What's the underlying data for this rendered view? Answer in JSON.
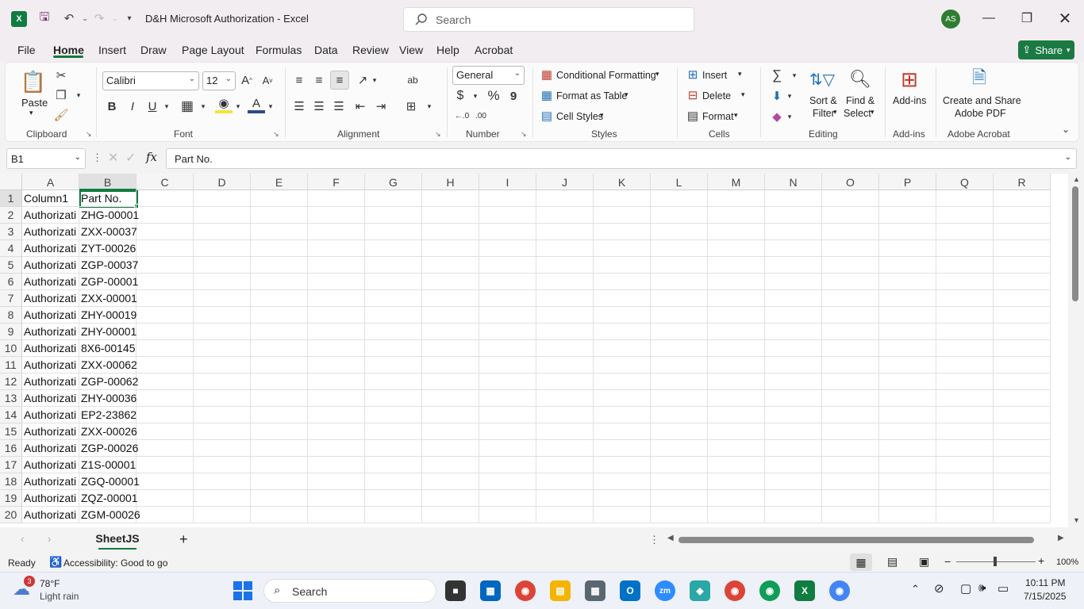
{
  "window": {
    "title": "D&H Microsoft Authorization  -  Excel",
    "search_placeholder": "Search",
    "avatar_initials": "AS"
  },
  "menu": [
    "File",
    "Home",
    "Insert",
    "Draw",
    "Page Layout",
    "Formulas",
    "Data",
    "Review",
    "View",
    "Help",
    "Acrobat"
  ],
  "share_label": "Share",
  "ribbon": {
    "clipboard": {
      "paste": "Paste",
      "label": "Clipboard"
    },
    "font": {
      "name": "Calibri",
      "size": "12",
      "label": "Font",
      "bold": "B",
      "italic": "I",
      "underline": "U"
    },
    "alignment": {
      "label": "Alignment"
    },
    "number": {
      "format": "General",
      "label": "Number",
      "currency": "$",
      "percent": "%",
      "comma": "9"
    },
    "styles": {
      "conditional": "Conditional Formatting",
      "table": "Format as Table",
      "cell": "Cell Styles",
      "label": "Styles"
    },
    "cells": {
      "insert": "Insert",
      "delete": "Delete",
      "format": "Format",
      "label": "Cells"
    },
    "editing": {
      "sort1": "Sort &",
      "sort2": "Filter",
      "find1": "Find &",
      "find2": "Select",
      "label": "Editing"
    },
    "addins": {
      "btn": "Add-ins",
      "label": "Add-ins"
    },
    "acrobat": {
      "btn1": "Create and Share",
      "btn2": "Adobe PDF",
      "label": "Adobe Acrobat"
    }
  },
  "formula_bar": {
    "name_box": "B1",
    "fx": "fx",
    "content": "Part No."
  },
  "columns": [
    "A",
    "B",
    "C",
    "D",
    "E",
    "F",
    "G",
    "H",
    "I",
    "J",
    "K",
    "L",
    "M",
    "N",
    "O",
    "P",
    "Q",
    "R"
  ],
  "rows": [
    {
      "n": "1",
      "a": "Column1",
      "b": "Part No."
    },
    {
      "n": "2",
      "a": "Authorizati",
      "b": "ZHG-00001"
    },
    {
      "n": "3",
      "a": "Authorizati",
      "b": "ZXX-00037"
    },
    {
      "n": "4",
      "a": "Authorizati",
      "b": "ZYT-00026"
    },
    {
      "n": "5",
      "a": "Authorizati",
      "b": "ZGP-00037"
    },
    {
      "n": "6",
      "a": "Authorizati",
      "b": "ZGP-00001"
    },
    {
      "n": "7",
      "a": "Authorizati",
      "b": "ZXX-00001"
    },
    {
      "n": "8",
      "a": "Authorizati",
      "b": "ZHY-00019"
    },
    {
      "n": "9",
      "a": "Authorizati",
      "b": "ZHY-00001"
    },
    {
      "n": "10",
      "a": "Authorizati",
      "b": "8X6-00145"
    },
    {
      "n": "11",
      "a": "Authorizati",
      "b": "ZXX-00062"
    },
    {
      "n": "12",
      "a": "Authorizati",
      "b": "ZGP-00062"
    },
    {
      "n": "13",
      "a": "Authorizati",
      "b": "ZHY-00036"
    },
    {
      "n": "14",
      "a": "Authorizati",
      "b": "EP2-23862"
    },
    {
      "n": "15",
      "a": "Authorizati",
      "b": "ZXX-00026"
    },
    {
      "n": "16",
      "a": "Authorizati",
      "b": "ZGP-00026"
    },
    {
      "n": "17",
      "a": "Authorizati",
      "b": "Z1S-00001"
    },
    {
      "n": "18",
      "a": "Authorizati",
      "b": "ZGQ-00001"
    },
    {
      "n": "19",
      "a": "Authorizati",
      "b": "ZQZ-00001"
    },
    {
      "n": "20",
      "a": "Authorizati",
      "b": "ZGM-00026"
    }
  ],
  "sheet_tab": "SheetJS",
  "status": {
    "ready": "Ready",
    "accessibility": "Accessibility: Good to go",
    "zoom": "100%"
  },
  "taskbar": {
    "weather_temp": "78°F",
    "weather_desc": "Light rain",
    "weather_badge": "3",
    "search": "Search",
    "time": "10:11 PM",
    "date": "7/15/2025"
  },
  "colors": {
    "excel_green": "#107c41",
    "share_green": "#1b7a43"
  }
}
